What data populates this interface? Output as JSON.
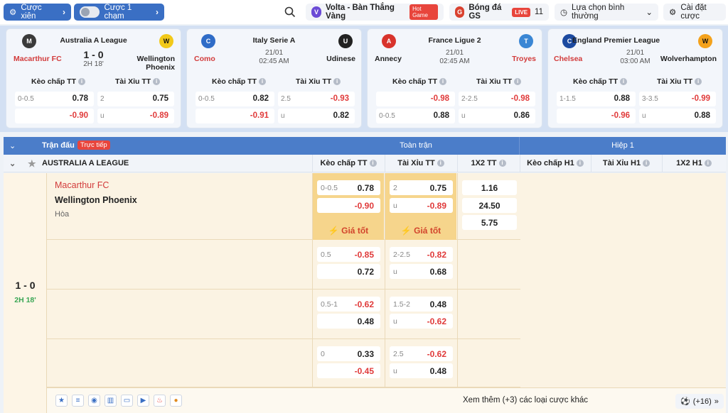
{
  "topbar": {
    "cuoc_xien": "Cược xiên",
    "cuoc_1_cham": "Cược 1 chạm",
    "volta": "Volta - Bàn Thắng Vàng",
    "hot_game": "Hot Game",
    "bong_da_gs": "Bóng đá GS",
    "live_label": "LIVE",
    "live_count": "11",
    "lua_chon": "Lựa chọn bình thường",
    "cai_dat": "Cài đặt cược"
  },
  "cards": [
    {
      "league": "Australia A League",
      "home": "Macarthur FC",
      "away": "Wellington Phoenix",
      "score": "1 - 0",
      "minute": "2H 18'",
      "hdp_label": "Kèo chấp TT",
      "ou_label": "Tài Xỉu TT",
      "r1": {
        "hl": "0-0.5",
        "hv": "0.78",
        "ol": "2",
        "ov": "0.75"
      },
      "r2": {
        "hl": "",
        "hv": "-0.90",
        "ol": "u",
        "ov": "-0.89"
      }
    },
    {
      "league": "Italy Serie A",
      "home": "Como",
      "away": "Udinese",
      "date": "21/01",
      "time": "02:45 AM",
      "hdp_label": "Kèo chấp TT",
      "ou_label": "Tài Xỉu TT",
      "r1": {
        "hl": "0-0.5",
        "hv": "0.82",
        "ol": "2.5",
        "ov": "-0.93"
      },
      "r2": {
        "hl": "",
        "hv": "-0.91",
        "ol": "u",
        "ov": "0.82"
      }
    },
    {
      "league": "France Ligue 2",
      "home": "Annecy",
      "away": "Troyes",
      "date": "21/01",
      "time": "02:45 AM",
      "hdp_label": "Kèo chấp TT",
      "ou_label": "Tài Xỉu TT",
      "r1": {
        "hl": "",
        "hv": "-0.98",
        "ol": "2-2.5",
        "ov": "-0.98"
      },
      "r2": {
        "hl": "0-0.5",
        "hv": "0.88",
        "ol": "u",
        "ov": "0.86"
      }
    },
    {
      "league": "England Premier League",
      "home": "Chelsea",
      "away": "Wolverhampton",
      "date": "21/01",
      "time": "03:00 AM",
      "hdp_label": "Kèo chấp TT",
      "ou_label": "Tài Xỉu TT",
      "r1": {
        "hl": "1-1.5",
        "hv": "0.88",
        "ol": "3-3.5",
        "ov": "-0.99"
      },
      "r2": {
        "hl": "",
        "hv": "-0.96",
        "ol": "u",
        "ov": "0.88"
      }
    }
  ],
  "table": {
    "tran_dau": "Trận đấu",
    "truc_tiep": "Trực tiếp",
    "toan_tran": "Toàn trận",
    "hiep1": "Hiệp 1",
    "league": "AUSTRALIA A LEAGUE",
    "cols": [
      "Kèo chấp TT",
      "Tài Xỉu TT",
      "1X2 TT",
      "Kèo chấp H1",
      "Tài Xỉu H1",
      "1X2 H1"
    ],
    "score": "1 - 0",
    "minute": "2H 18'",
    "home": "Macarthur FC",
    "away": "Wellington Phoenix",
    "draw": "Hòa",
    "gia_tot": "Giá tốt",
    "rows": [
      {
        "h1l": "0-0.5",
        "h1v": "0.78",
        "h2l": "",
        "h2v": "-0.90",
        "o1l": "2",
        "o1v": "0.75",
        "o2l": "u",
        "o2v": "-0.89"
      },
      {
        "h1l": "0.5",
        "h1v": "-0.85",
        "h2l": "",
        "h2v": "0.72",
        "o1l": "2-2.5",
        "o1v": "-0.82",
        "o2l": "u",
        "o2v": "0.68"
      },
      {
        "h1l": "0.5-1",
        "h1v": "-0.62",
        "h2l": "",
        "h2v": "0.48",
        "o1l": "1.5-2",
        "o1v": "0.48",
        "o2l": "u",
        "o2v": "-0.62"
      },
      {
        "h1l": "0",
        "h1v": "0.33",
        "h2l": "",
        "h2v": "-0.45",
        "o1l": "2.5",
        "o1v": "-0.62",
        "o2l": "u",
        "o2v": "0.48"
      }
    ],
    "x12": [
      "1.16",
      "24.50",
      "5.75"
    ],
    "xem_them": "Xem thêm (+3) các loại cược khác",
    "plus16": "(+16)"
  }
}
